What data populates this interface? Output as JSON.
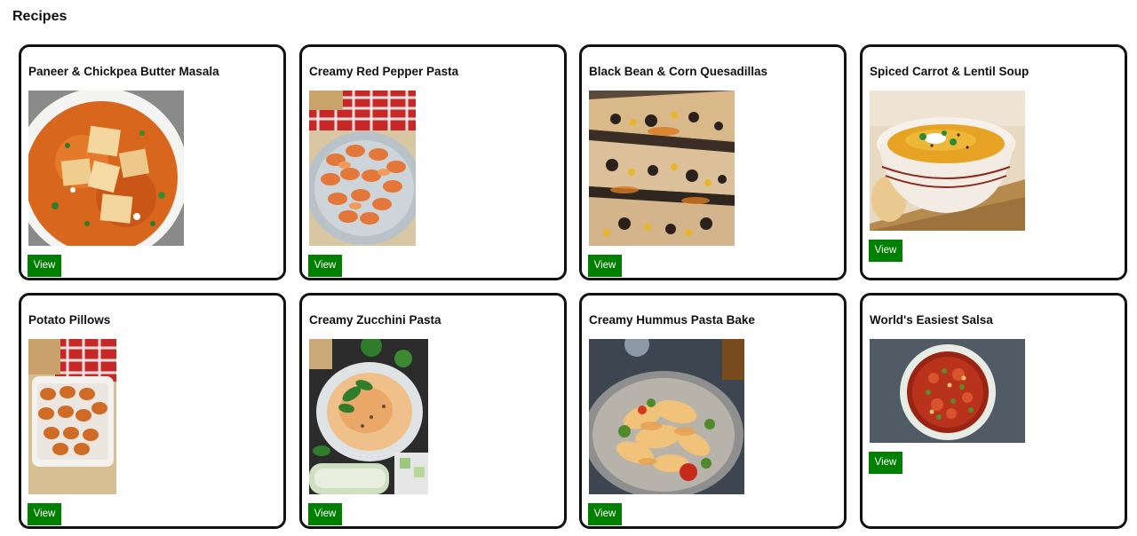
{
  "page": {
    "title": "Recipes"
  },
  "recipes": [
    {
      "title": "Paneer & Chickpea Butter Masala",
      "image": "paneer-butter-masala-image",
      "button_label": "View"
    },
    {
      "title": "Creamy Red Pepper Pasta",
      "image": "red-pepper-pasta-image",
      "button_label": "View"
    },
    {
      "title": "Black Bean & Corn Quesadillas",
      "image": "quesadillas-image",
      "button_label": "View"
    },
    {
      "title": "Spiced Carrot & Lentil Soup",
      "image": "carrot-lentil-soup-image",
      "button_label": "View"
    },
    {
      "title": "Potato Pillows",
      "image": "potato-pillows-image",
      "button_label": "View"
    },
    {
      "title": "Creamy Zucchini Pasta",
      "image": "zucchini-pasta-image",
      "button_label": "View"
    },
    {
      "title": "Creamy Hummus Pasta Bake",
      "image": "hummus-pasta-bake-image",
      "button_label": "View"
    },
    {
      "title": "World's Easiest Salsa",
      "image": "salsa-image",
      "button_label": "View"
    }
  ],
  "colors": {
    "button_bg": "#008000",
    "button_text": "#ffffff",
    "card_border": "#111111"
  }
}
